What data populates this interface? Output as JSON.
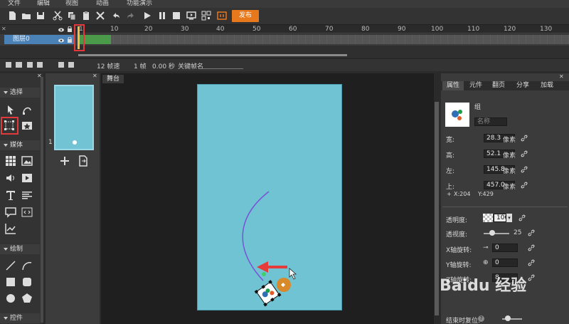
{
  "menu": [
    "文件",
    "编辑",
    "视图",
    "动画",
    "功能演示"
  ],
  "toolbar": {
    "publish_label": "发布"
  },
  "timeline": {
    "ticks": [
      "1",
      "10",
      "20",
      "30",
      "40",
      "50",
      "60",
      "70",
      "80",
      "90",
      "100",
      "110",
      "120",
      "130"
    ],
    "layer_name": "图层0"
  },
  "status": {
    "fps": "12 帧速",
    "frame": "1 帧",
    "time": "0.00 秒",
    "keyframe_name_label": "关键帧名"
  },
  "tools": {
    "sections": [
      "选择",
      "媒体",
      "绘制",
      "控件"
    ]
  },
  "thumbs": {
    "frame_number": "1"
  },
  "stage": {
    "tab_label": "舞台"
  },
  "props": {
    "tabs": [
      "属性",
      "元件",
      "翻页",
      "分享",
      "加载"
    ],
    "group_label": "组",
    "name_placeholder": "名称",
    "width_label": "宽:",
    "width_value": "28.3",
    "height_label": "高:",
    "height_value": "52.1",
    "left_label": "左:",
    "left_value": "145.8",
    "top_label": "上:",
    "top_value": "457.0",
    "unit": "像素",
    "coord_x": "X:204",
    "coord_y": "Y:429",
    "opacity_label": "透明度:",
    "opacity_value": "100",
    "perspective_label": "透视度:",
    "perspective_value": "25",
    "xrot_label": "X轴旋转:",
    "xrot_value": "0",
    "yrot_label": "Y轴旋转:",
    "yrot_value": "0",
    "zrot_label": "Z轴旋转:",
    "zrot_value": "8",
    "reset_label": "结束时复位:"
  },
  "watermark": "Baidu 经验",
  "colors": {
    "accent": "#e8781c",
    "stage": "#6fc3d3",
    "keyframe": "#4b9a4a",
    "highlight": "#e23a3a",
    "path": "#7a52d6",
    "arrow": "#e53b3b"
  }
}
